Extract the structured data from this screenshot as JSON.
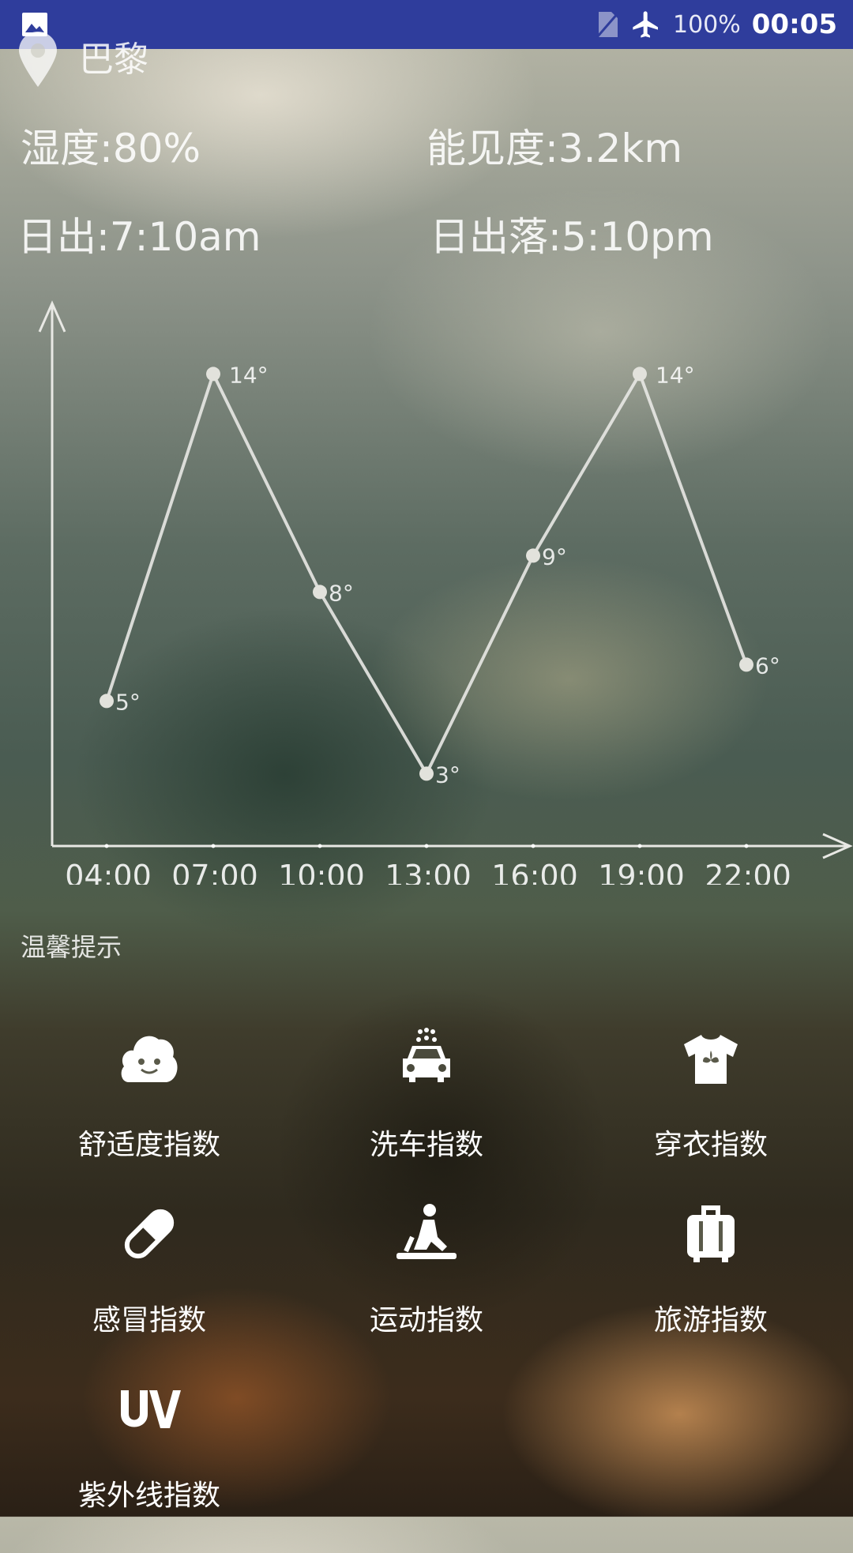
{
  "status_bar": {
    "battery": "100%",
    "time": "00:05"
  },
  "location": {
    "city": "巴黎"
  },
  "details": {
    "humidity": "湿度:80%",
    "visibility": "能见度:3.2km",
    "sunrise": "日出:7:10am",
    "sunset": "日出落:5:10pm"
  },
  "chart_data": {
    "type": "line",
    "x": [
      "04:00",
      "07:00",
      "10:00",
      "13:00",
      "16:00",
      "19:00",
      "22:00"
    ],
    "series": [
      {
        "values": [
          5,
          14,
          8,
          3,
          9,
          14,
          6
        ]
      }
    ],
    "point_labels": [
      "5°",
      "14°",
      "8°",
      "3°",
      "9°",
      "14°",
      "6°"
    ]
  },
  "tips": {
    "title": "温馨提示",
    "items": [
      {
        "label": "舒适度指数",
        "icon": "comfort-face-icon"
      },
      {
        "label": "洗车指数",
        "icon": "car-wash-icon"
      },
      {
        "label": "穿衣指数",
        "icon": "shirt-icon"
      },
      {
        "label": "感冒指数",
        "icon": "pill-icon"
      },
      {
        "label": "运动指数",
        "icon": "exercise-icon"
      },
      {
        "label": "旅游指数",
        "icon": "luggage-icon"
      },
      {
        "label": "紫外线指数",
        "icon": "uv-icon"
      }
    ]
  },
  "colors": {
    "status_bar": "#2f3d9c",
    "chart_line": "#e8e8e4"
  }
}
